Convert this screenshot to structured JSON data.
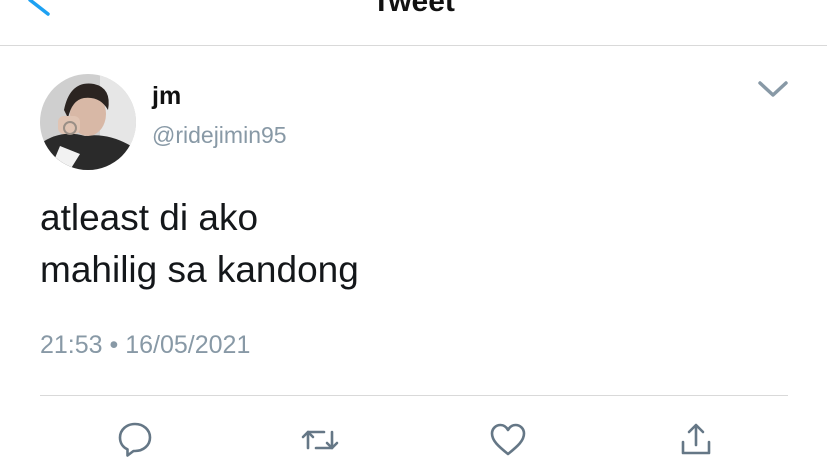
{
  "header": {
    "title": "Tweet",
    "back_icon": "back-chevron-icon"
  },
  "tweet": {
    "author": {
      "name": "jm",
      "handle": "@ridejimin95",
      "avatar": "profile-photo"
    },
    "text_lines": [
      "atleast di ako",
      "mahilig sa kandong"
    ],
    "time": "21:53",
    "separator": "•",
    "date": "16/05/2021"
  },
  "actions": [
    {
      "icon": "reply-icon"
    },
    {
      "icon": "retweet-icon"
    },
    {
      "icon": "like-icon"
    },
    {
      "icon": "share-icon"
    }
  ],
  "colors": {
    "accent": "#1da1f2",
    "secondary_text": "#8899a6",
    "icon": "#657786",
    "divider": "#d9d9d9"
  }
}
